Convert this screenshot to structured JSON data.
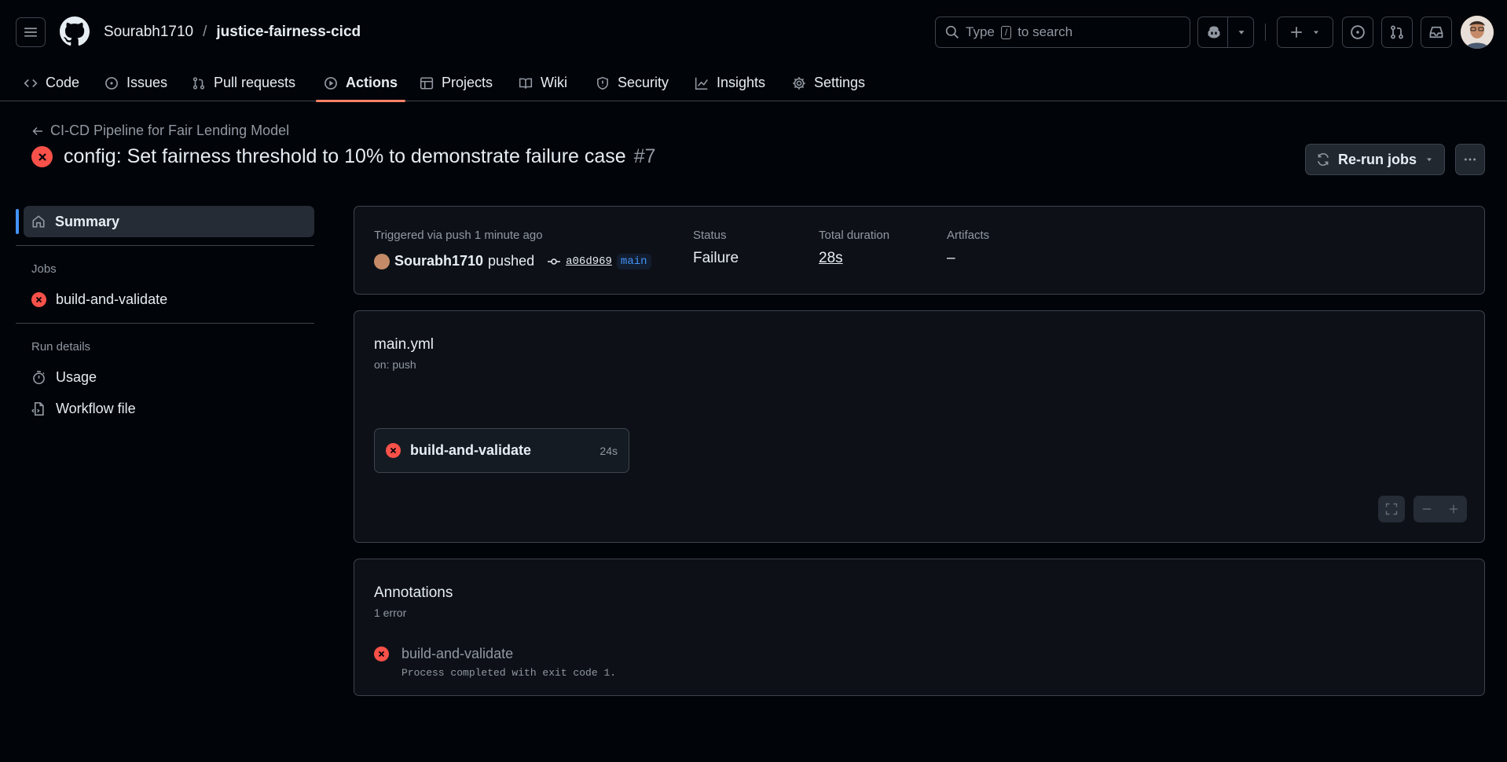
{
  "header": {
    "owner": "Sourabh1710",
    "separator": "/",
    "repo": "justice-fairness-cicd",
    "search_placeholder": "Type / to search",
    "search_prefix": "Type",
    "search_key": "/",
    "search_suffix": "to search"
  },
  "tabs": [
    {
      "label": "Code",
      "icon": "code-icon"
    },
    {
      "label": "Issues",
      "icon": "issue-icon"
    },
    {
      "label": "Pull requests",
      "icon": "pull-request-icon"
    },
    {
      "label": "Actions",
      "icon": "play-icon",
      "active": true
    },
    {
      "label": "Projects",
      "icon": "table-icon"
    },
    {
      "label": "Wiki",
      "icon": "book-icon"
    },
    {
      "label": "Security",
      "icon": "shield-icon"
    },
    {
      "label": "Insights",
      "icon": "graph-icon"
    },
    {
      "label": "Settings",
      "icon": "gear-icon"
    }
  ],
  "run": {
    "back_label": "CI-CD Pipeline for Fair Lending Model",
    "title": "config: Set fairness threshold to 10% to demonstrate failure case",
    "number": "#7",
    "rerun_label": "Re-run jobs"
  },
  "sidebar": {
    "summary_label": "Summary",
    "jobs_heading": "Jobs",
    "job_label": "build-and-validate",
    "run_details_heading": "Run details",
    "usage_label": "Usage",
    "workflow_file_label": "Workflow file"
  },
  "summary": {
    "triggered_label": "Triggered via push 1 minute ago",
    "user": "Sourabh1710",
    "action": "pushed",
    "commit": "a06d969",
    "branch": "main",
    "status_label": "Status",
    "status_value": "Failure",
    "duration_label": "Total duration",
    "duration_value": "28s",
    "artifacts_label": "Artifacts",
    "artifacts_value": "–"
  },
  "workflow": {
    "filename": "main.yml",
    "trigger": "on: push",
    "job_name": "build-and-validate",
    "job_duration": "24s"
  },
  "annotations": {
    "heading": "Annotations",
    "count": "1 error",
    "item_title": "build-and-validate",
    "item_message": "Process completed with exit code 1."
  },
  "colors": {
    "accent_tab": "#f78166",
    "error": "#f85149",
    "link_blue": "#4493f8"
  }
}
